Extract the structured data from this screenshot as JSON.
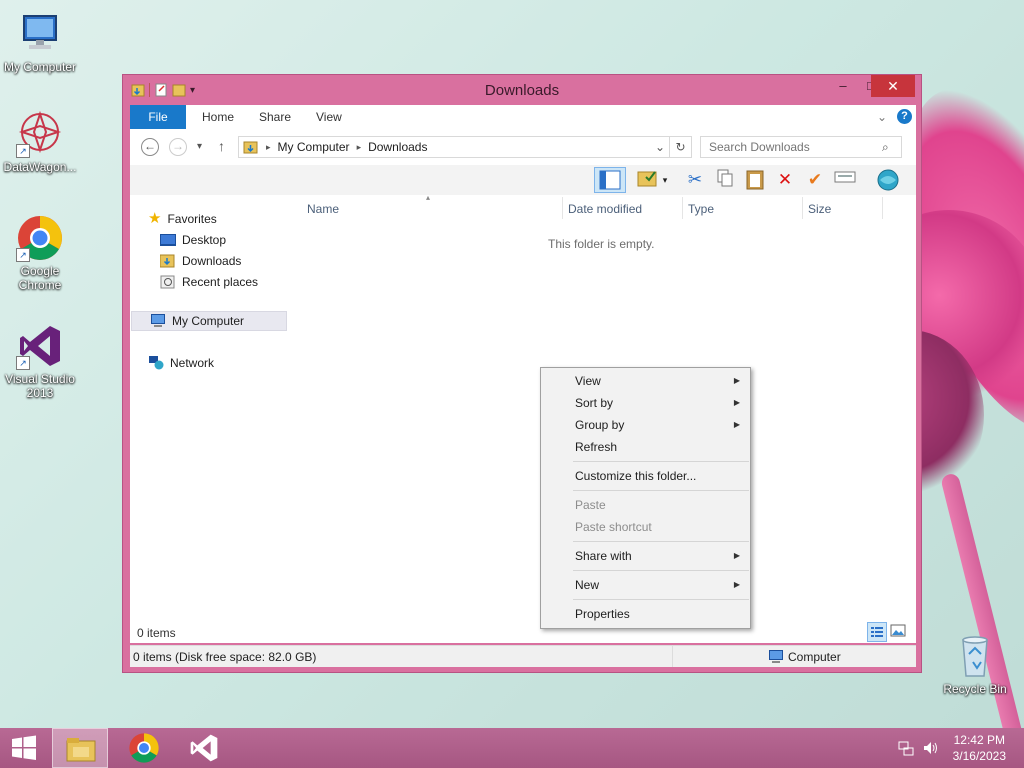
{
  "desktop": {
    "icons": [
      {
        "label": "My Computer",
        "icon": "computer-icon"
      },
      {
        "label": "DataWagon...",
        "icon": "datawagon-icon"
      },
      {
        "label": "Google Chrome",
        "icon": "chrome-icon"
      },
      {
        "label": "Visual Studio 2013",
        "icon": "visual-studio-icon"
      },
      {
        "label": "Recycle Bin",
        "icon": "recycle-bin-icon"
      }
    ]
  },
  "window": {
    "title": "Downloads",
    "minimize": "–",
    "maximize": "□",
    "close": "✕"
  },
  "ribbon": {
    "tabs": [
      {
        "label": "File"
      },
      {
        "label": "Home"
      },
      {
        "label": "Share"
      },
      {
        "label": "View"
      }
    ],
    "expand_glyph": "⌄",
    "help_glyph": "?"
  },
  "address": {
    "back": "←",
    "forward": "→",
    "recent": "▾",
    "up": "↑",
    "path": [
      {
        "label": "My Computer"
      },
      {
        "label": "Downloads"
      }
    ],
    "sep": "▸",
    "dropdown": "⌄",
    "refresh": "↻",
    "search_placeholder": "Search Downloads",
    "search_icon": "⌕"
  },
  "navpane": {
    "favorites": "Favorites",
    "desktop": "Desktop",
    "downloads": "Downloads",
    "recent": "Recent places",
    "my_computer": "My Computer",
    "network": "Network"
  },
  "columns": [
    {
      "label": "Name"
    },
    {
      "label": "Date modified"
    },
    {
      "label": "Type"
    },
    {
      "label": "Size"
    }
  ],
  "empty_message": "This folder is empty.",
  "items_count": "0 items",
  "status": {
    "left": "0 items (Disk free space: 82.0 GB)",
    "right": "Computer"
  },
  "context_menu": {
    "view": "View",
    "sort_by": "Sort by",
    "group_by": "Group by",
    "refresh": "Refresh",
    "customize": "Customize this folder...",
    "paste": "Paste",
    "paste_shortcut": "Paste shortcut",
    "share_with": "Share with",
    "new": "New",
    "properties": "Properties",
    "arrow": "▶"
  },
  "taskbar": {
    "time": "12:42 PM",
    "date": "3/16/2023"
  },
  "colors": {
    "accent": "#1979ca",
    "window_frame": "#d9709f",
    "close_button": "#c7343c"
  }
}
